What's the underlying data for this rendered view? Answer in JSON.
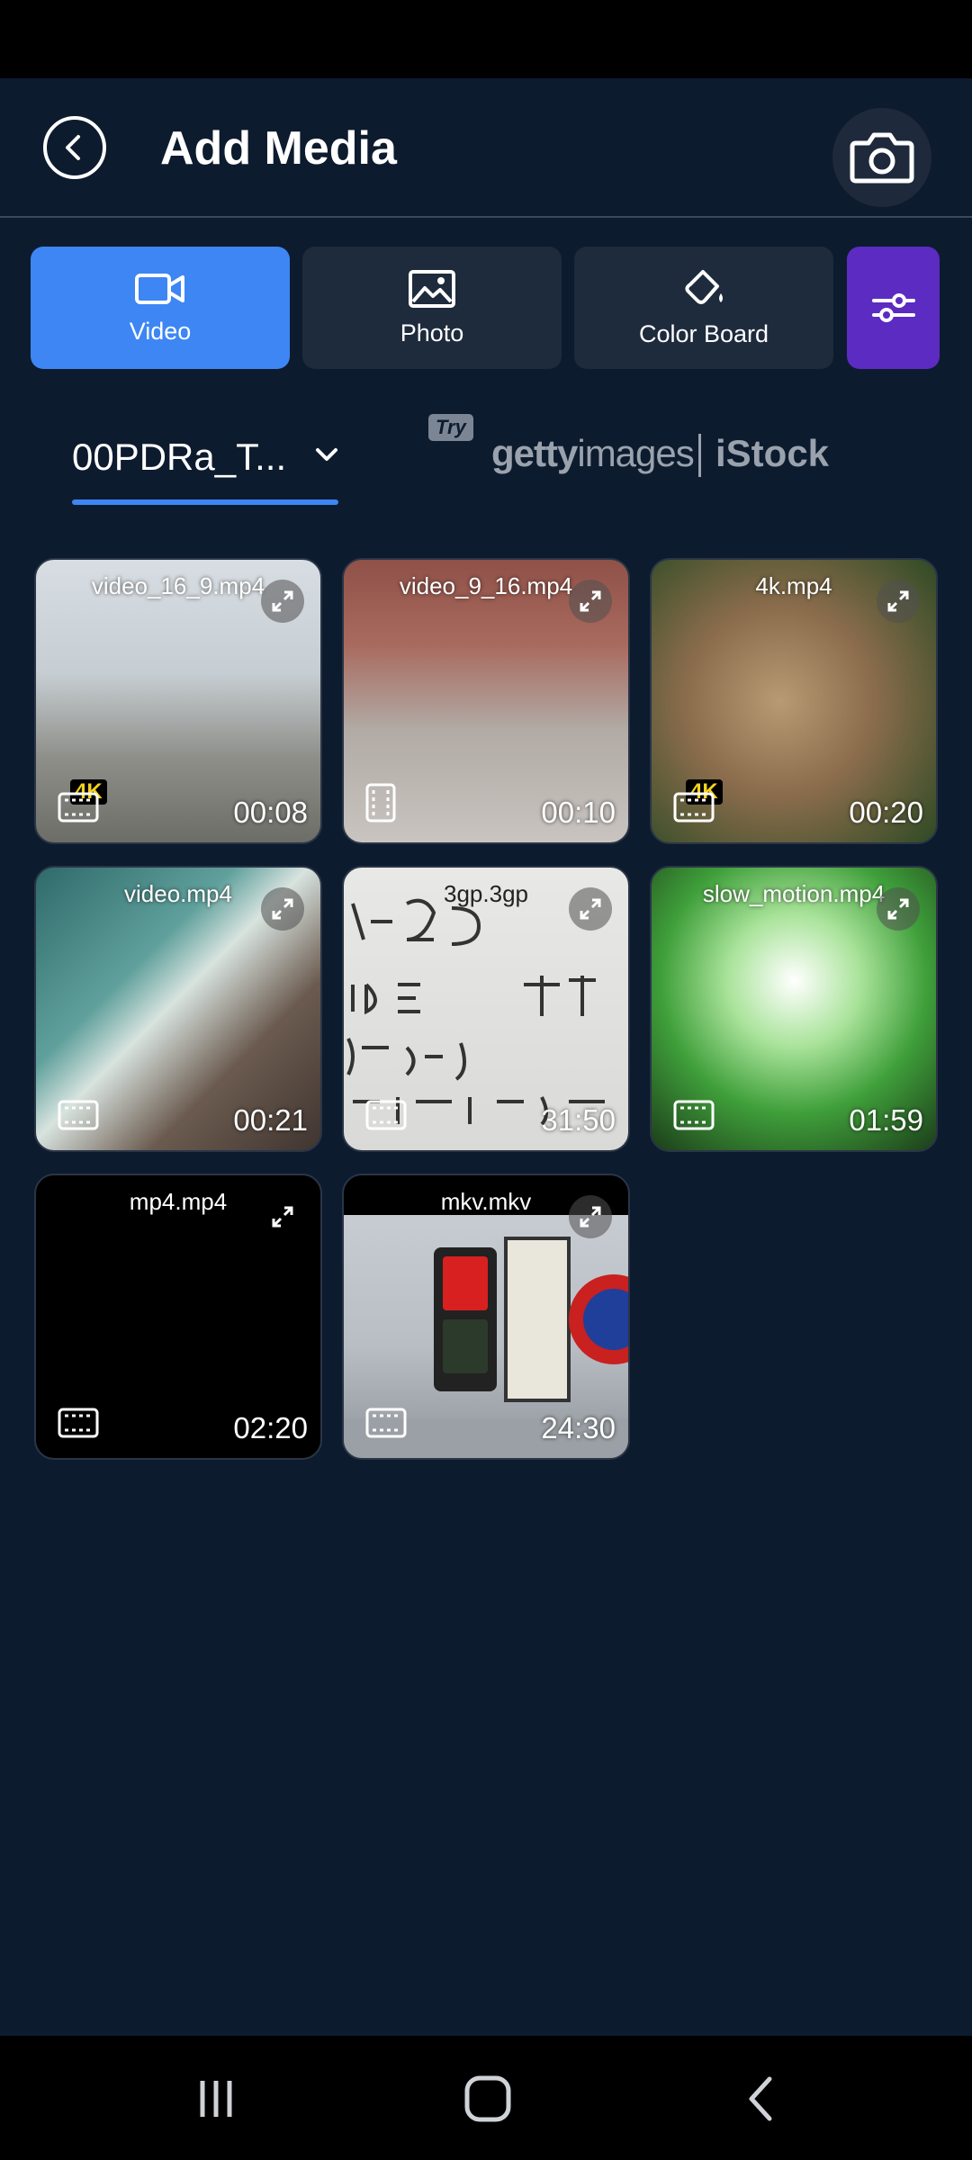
{
  "header": {
    "title": "Add Media"
  },
  "tabs": [
    {
      "label": "Video",
      "active": true,
      "icon": "video-camera-icon"
    },
    {
      "label": "Photo",
      "active": false,
      "icon": "image-icon"
    },
    {
      "label": "Color Board",
      "active": false,
      "icon": "paint-bucket-icon"
    }
  ],
  "source": {
    "folder": "00PDRa_T...",
    "try_badge": "Try",
    "getty_bold": "getty",
    "getty_light": "images",
    "istock": "iStock"
  },
  "media": [
    {
      "name": "video_16_9.mp4",
      "duration": "00:08",
      "badge": "4K",
      "type": "landscape"
    },
    {
      "name": "video_9_16.mp4",
      "duration": "00:10",
      "badge": "",
      "type": "portrait"
    },
    {
      "name": "4k.mp4",
      "duration": "00:20",
      "badge": "4K",
      "type": "landscape"
    },
    {
      "name": "video.mp4",
      "duration": "00:21",
      "badge": "",
      "type": "landscape"
    },
    {
      "name": "3gp.3gp",
      "duration": "31:50",
      "badge": "",
      "type": "landscape"
    },
    {
      "name": "slow_motion.mp4",
      "duration": "01:59",
      "badge": "",
      "type": "landscape"
    },
    {
      "name": "mp4.mp4",
      "duration": "02:20",
      "badge": "",
      "type": "landscape"
    },
    {
      "name": "mkv.mkv",
      "duration": "24:30",
      "badge": "",
      "type": "landscape"
    }
  ],
  "colors": {
    "background": "#0d1b2e",
    "accent": "#3d86f4",
    "filter": "#5b2bc2"
  }
}
